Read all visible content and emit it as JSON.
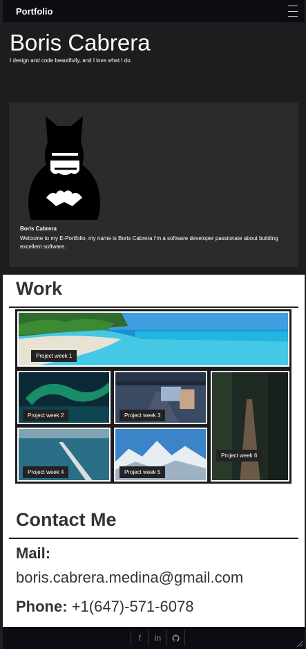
{
  "nav": {
    "brand": "Portfolio",
    "menu_icon": "hamburger-icon"
  },
  "hero": {
    "name": "Boris Cabrera",
    "tagline": "I design and code beautifully, and I love what I do.",
    "card": {
      "avatar_icon": "batman-avatar",
      "name": "Boris Cabrera",
      "text": "Welcome to my E-Portfolio, my name is Boris Cabrera I'm a software developer passionate about building excellent software."
    }
  },
  "work": {
    "title": "Work",
    "projects": [
      {
        "label": "Project week 1",
        "image": "tropical-beach"
      },
      {
        "label": "Project week 2",
        "image": "aurora-lake"
      },
      {
        "label": "Project week 3",
        "image": "highway-phone-photo"
      },
      {
        "label": "Project week 4",
        "image": "sea-bridge-aerial"
      },
      {
        "label": "Project week 5",
        "image": "snowy-mountains"
      },
      {
        "label": "Project week 6",
        "image": "forest-suspension-bridge"
      }
    ]
  },
  "contact": {
    "title": "Contact Me",
    "mail_label": "Mail:",
    "mail": "boris.cabrera.medina@gmail.com",
    "phone_label": "Phone:",
    "phone": "+1(647)-571-6078"
  },
  "footer": {
    "social": [
      {
        "glyph": "f",
        "icon": "facebook-icon"
      },
      {
        "glyph": "in",
        "icon": "linkedin-icon"
      }
    ],
    "github_icon": "github-icon"
  },
  "colors": {
    "nav_bg": "#0b0d12",
    "hero_bg": "#1d1d1f",
    "card_bg": "#2b2b2e",
    "text_dark": "#333333"
  }
}
